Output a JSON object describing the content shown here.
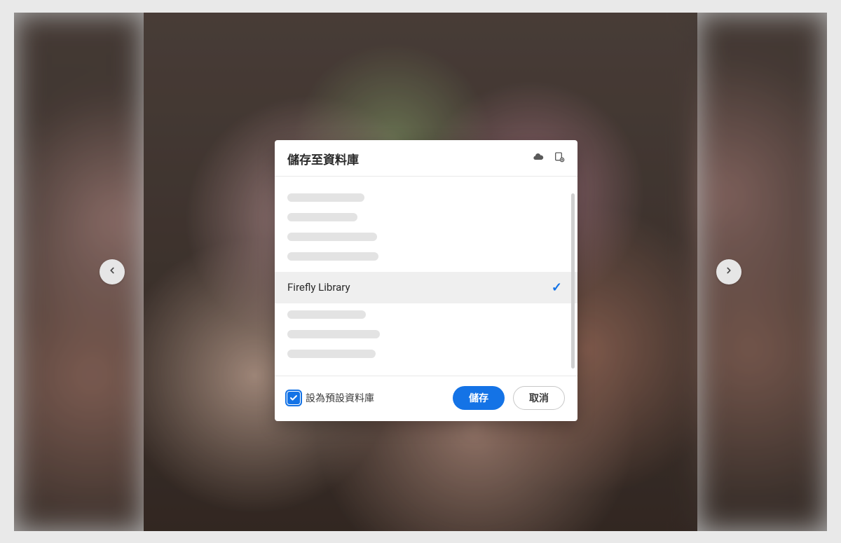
{
  "dialog": {
    "title": "儲存至資料庫",
    "selected_library": "Firefly Library",
    "checkbox_label": "設為預設資料庫",
    "save_label": "儲存",
    "cancel_label": "取消"
  }
}
